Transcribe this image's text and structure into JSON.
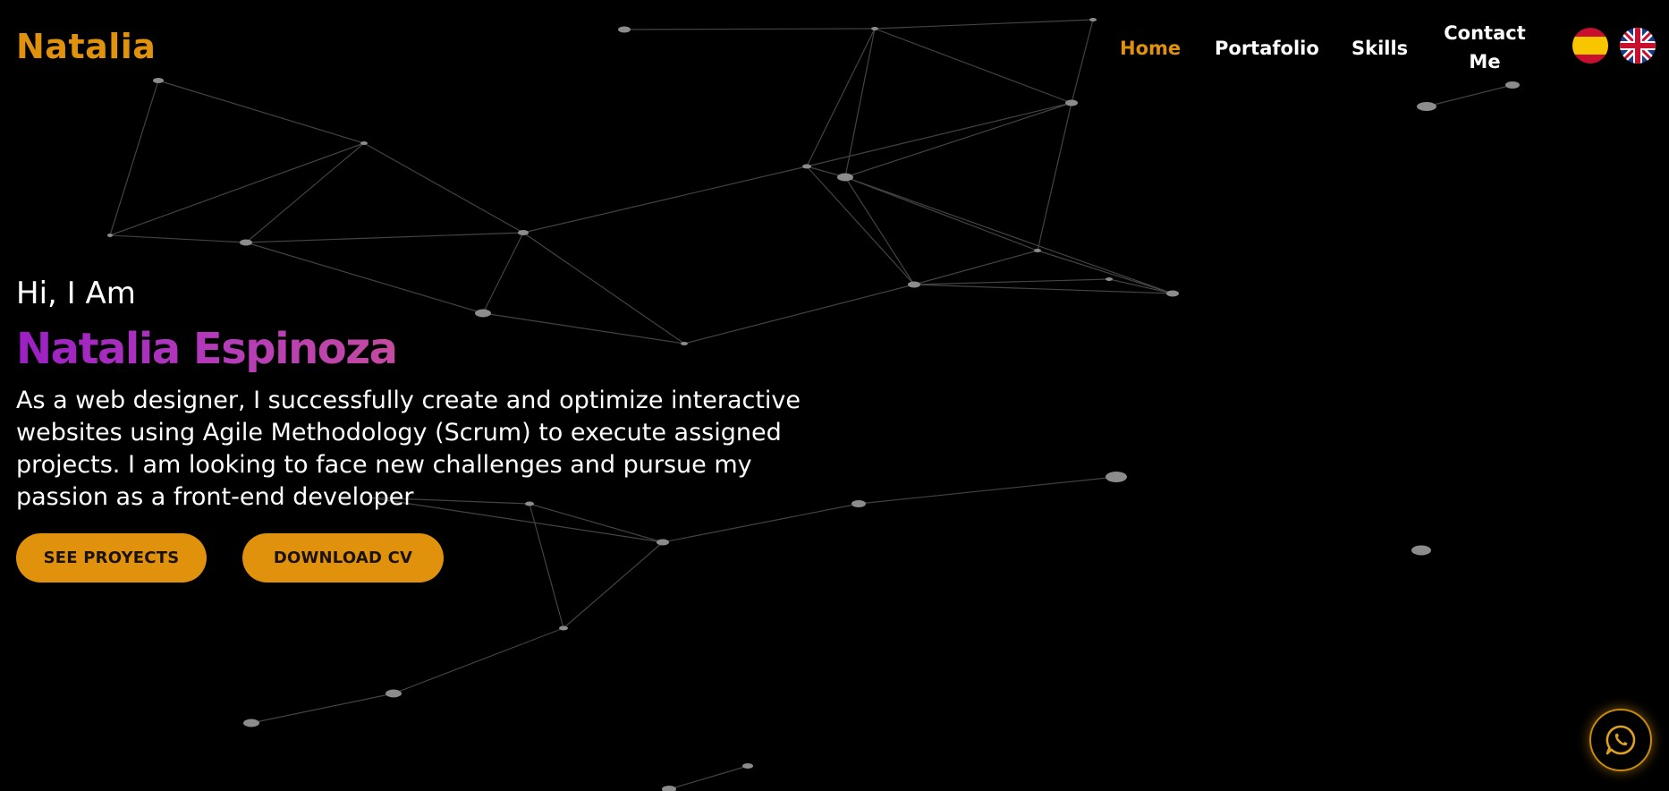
{
  "theme": {
    "accent": "#e0920c",
    "background": "#000000",
    "text": "#ffffff",
    "name_gradient": [
      "#9b1fc4",
      "#c44aa0"
    ]
  },
  "header": {
    "logo": "Natalia",
    "nav": [
      {
        "label": "Home",
        "active": true
      },
      {
        "label": "Portafolio",
        "active": false
      },
      {
        "label": "Skills",
        "active": false
      },
      {
        "label": "Contact Me",
        "active": false
      }
    ],
    "languages": [
      {
        "icon": "spain-flag-icon",
        "lang": "es"
      },
      {
        "icon": "uk-flag-icon",
        "lang": "en"
      }
    ]
  },
  "hero": {
    "greeting": "Hi, I Am",
    "name": "Natalia Espinoza",
    "description": "As a web designer, I successfully create and optimize interactive websites using Agile Methodology (Scrum) to execute assigned projects. I am looking to face new challenges and pursue my passion as a front-end developer",
    "buttons": {
      "projects": "SEE PROYECTS",
      "cv": "DOWNLOAD CV"
    }
  },
  "floating": {
    "whatsapp_icon": "whatsapp-icon"
  }
}
